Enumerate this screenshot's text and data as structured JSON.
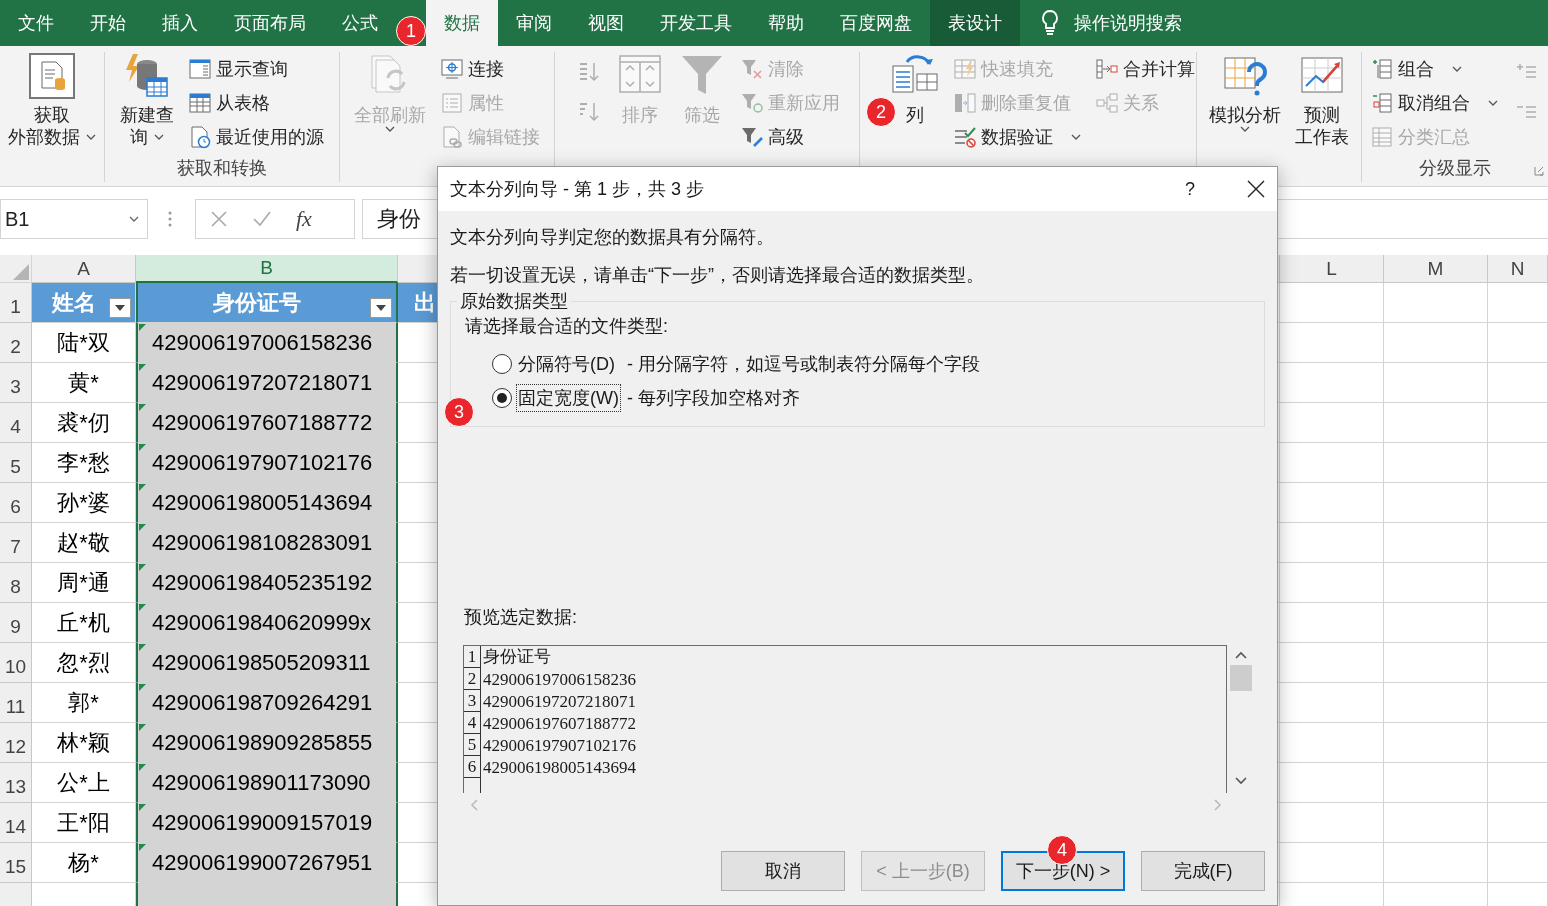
{
  "tabs": [
    {
      "label": "文件",
      "selected": false,
      "contextual": false
    },
    {
      "label": "开始",
      "selected": false,
      "contextual": false
    },
    {
      "label": "插入",
      "selected": false,
      "contextual": false
    },
    {
      "label": "页面布局",
      "selected": false,
      "contextual": false
    },
    {
      "label": "公式",
      "selected": false,
      "contextual": false
    },
    {
      "label": "数据",
      "selected": true,
      "contextual": false
    },
    {
      "label": "审阅",
      "selected": false,
      "contextual": false
    },
    {
      "label": "视图",
      "selected": false,
      "contextual": false
    },
    {
      "label": "开发工具",
      "selected": false,
      "contextual": false
    },
    {
      "label": "帮助",
      "selected": false,
      "contextual": false
    },
    {
      "label": "百度网盘",
      "selected": false,
      "contextual": false
    },
    {
      "label": "表设计",
      "selected": false,
      "contextual": true
    }
  ],
  "search": {
    "label": "操作说明搜索"
  },
  "ribbon": {
    "groups": [
      {
        "columns": [
          {
            "items": [
              {
                "kind": "large",
                "lines": [
                  "获取",
                  "外部数据"
                ],
                "disabled": false,
                "dropdown": true
              }
            ]
          }
        ]
      },
      {
        "label": "获取和转换",
        "columns": [
          {
            "items": [
              {
                "kind": "large",
                "lines": [
                  "新建查",
                  "询"
                ],
                "disabled": false,
                "dropdown": true
              }
            ]
          },
          {
            "items": [
              {
                "kind": "small",
                "label": "显示查询",
                "disabled": false,
                "dropdown": false
              },
              {
                "kind": "small",
                "label": "从表格",
                "disabled": false,
                "dropdown": false
              },
              {
                "kind": "small",
                "label": "最近使用的源",
                "disabled": false,
                "dropdown": false
              }
            ]
          }
        ]
      },
      {
        "columns": [
          {
            "items": [
              {
                "kind": "large",
                "lines": [
                  "全部刷新"
                ],
                "disabled": true,
                "dropdown": true
              }
            ]
          },
          {
            "items": [
              {
                "kind": "small",
                "label": "连接",
                "disabled": false,
                "dropdown": false
              },
              {
                "kind": "small",
                "label": "属性",
                "disabled": true,
                "dropdown": false
              },
              {
                "kind": "small",
                "label": "编辑链接",
                "disabled": true,
                "dropdown": false
              }
            ]
          }
        ]
      },
      {
        "columns": [
          {
            "items": [
              {
                "kind": "icon",
                "disabled": true,
                "dropdown": false
              },
              {
                "kind": "icon",
                "disabled": true,
                "dropdown": false
              }
            ]
          },
          {
            "items": [
              {
                "kind": "large",
                "lines": [
                  "排序"
                ],
                "disabled": true,
                "dropdown": false
              }
            ]
          },
          {
            "items": [
              {
                "kind": "large",
                "lines": [
                  "筛选"
                ],
                "disabled": true,
                "dropdown": false
              }
            ]
          },
          {
            "items": [
              {
                "kind": "small",
                "label": "清除",
                "disabled": true,
                "dropdown": false
              },
              {
                "kind": "small",
                "label": "重新应用",
                "disabled": true,
                "dropdown": false
              },
              {
                "kind": "small",
                "label": "高级",
                "disabled": false,
                "dropdown": false
              }
            ]
          }
        ]
      },
      {
        "columns": [
          {
            "items": [
              {
                "kind": "large",
                "lines": [
                  "列"
                ],
                "disabled": false,
                "dropdown": false
              }
            ]
          },
          {
            "items": [
              {
                "kind": "small",
                "label": "快速填充",
                "disabled": true,
                "dropdown": false
              },
              {
                "kind": "small",
                "label": "删除重复值",
                "disabled": true,
                "dropdown": false
              },
              {
                "kind": "small",
                "label": "数据验证",
                "disabled": false,
                "dropdown": true
              }
            ]
          },
          {
            "items": [
              {
                "kind": "small",
                "label": "合并计算",
                "disabled": false,
                "dropdown": false
              },
              {
                "kind": "small",
                "label": "关系",
                "disabled": true,
                "dropdown": false
              }
            ]
          }
        ]
      },
      {
        "columns": [
          {
            "items": [
              {
                "kind": "large",
                "lines": [
                  "模拟分析"
                ],
                "disabled": false,
                "dropdown": true
              }
            ]
          },
          {
            "items": [
              {
                "kind": "large",
                "lines": [
                  "预测",
                  "工作表"
                ],
                "disabled": false,
                "dropdown": false
              }
            ]
          }
        ]
      },
      {
        "label": "分级显示",
        "columns": [
          {
            "items": [
              {
                "kind": "small",
                "label": "组合",
                "disabled": false,
                "dropdown": true
              },
              {
                "kind": "small",
                "label": "取消组合",
                "disabled": false,
                "dropdown": true
              },
              {
                "kind": "small",
                "label": "分类汇总",
                "disabled": true,
                "dropdown": false
              }
            ]
          },
          {
            "items": [
              {
                "kind": "icon",
                "disabled": true,
                "dropdown": false
              },
              {
                "kind": "icon",
                "disabled": true,
                "dropdown": false
              }
            ]
          }
        ]
      }
    ]
  },
  "formula_bar": {
    "name_box": "B1",
    "function_label": "fx",
    "value": "身份"
  },
  "sheet": {
    "columns": [
      {
        "label": "A",
        "selected": false
      },
      {
        "label": "B",
        "selected": true
      }
    ],
    "columns_far": [
      {
        "label": "L",
        "selected": false
      },
      {
        "label": "M",
        "selected": false
      },
      {
        "label": "N",
        "selected": false
      }
    ],
    "header_row": {
      "row_number": "1",
      "cells": [
        {
          "text": "姓名",
          "filter": true
        },
        {
          "text": "身份证号",
          "filter": true
        },
        {
          "text": "出",
          "filter": false
        }
      ]
    },
    "rows": [
      {
        "row_number": "2",
        "name": "陆*双",
        "id": "429006197006158236",
        "flagged": true
      },
      {
        "row_number": "3",
        "name": "黄*",
        "id": "429006197207218071",
        "flagged": true
      },
      {
        "row_number": "4",
        "name": "裘*仞",
        "id": "429006197607188772",
        "flagged": true
      },
      {
        "row_number": "5",
        "name": "李*愁",
        "id": "429006197907102176",
        "flagged": true
      },
      {
        "row_number": "6",
        "name": "孙*婆",
        "id": "429006198005143694",
        "flagged": true
      },
      {
        "row_number": "7",
        "name": "赵*敬",
        "id": "429006198108283091",
        "flagged": true
      },
      {
        "row_number": "8",
        "name": "周*通",
        "id": "429006198405235192",
        "flagged": true
      },
      {
        "row_number": "9",
        "name": "丘*机",
        "id": "42900619840620999x",
        "flagged": true
      },
      {
        "row_number": "10",
        "name": "忽*烈",
        "id": "429006198505209311",
        "flagged": true
      },
      {
        "row_number": "11",
        "name": "郭*",
        "id": "429006198709264291",
        "flagged": true
      },
      {
        "row_number": "12",
        "name": "林*颖",
        "id": "429006198909285855",
        "flagged": true
      },
      {
        "row_number": "13",
        "name": "公*上",
        "id": "429006198901173090",
        "flagged": true
      },
      {
        "row_number": "14",
        "name": "王*阳",
        "id": "429006199009157019",
        "flagged": true
      },
      {
        "row_number": "15",
        "name": "杨*",
        "id": "429006199007267951",
        "flagged": true
      }
    ]
  },
  "dialog": {
    "title": "文本分列向导 - 第 1 步，共 3 步",
    "help": "?",
    "intro": "文本分列向导判定您的数据具有分隔符。",
    "instruction": "若一切设置无误，请单击“下一步”，否则请选择最合适的数据类型。",
    "group_title": "原始数据类型",
    "prompt": "请选择最合适的文件类型:",
    "options": [
      {
        "label": "分隔符号(D)",
        "description": "- 用分隔字符，如逗号或制表符分隔每个字段",
        "selected": false
      },
      {
        "label": "固定宽度(W)",
        "description": "- 每列字段加空格对齐",
        "selected": true
      }
    ],
    "preview_label": "预览选定数据:",
    "preview_rows": [
      {
        "number": "1",
        "text": "身份证号"
      },
      {
        "number": "2",
        "text": "429006197006158236"
      },
      {
        "number": "3",
        "text": "429006197207218071"
      },
      {
        "number": "4",
        "text": "429006197607188772"
      },
      {
        "number": "5",
        "text": "429006197907102176"
      },
      {
        "number": "6",
        "text": "429006198005143694"
      }
    ],
    "buttons": [
      {
        "label": "取消",
        "disabled": false,
        "default": false
      },
      {
        "label": "< 上一步(B)",
        "disabled": true,
        "default": false
      },
      {
        "label": "下一步(N) >",
        "disabled": false,
        "default": true
      },
      {
        "label": "完成(F)",
        "disabled": false,
        "default": false
      }
    ]
  },
  "badges": [
    {
      "label": "1"
    },
    {
      "label": "2"
    },
    {
      "label": "3"
    },
    {
      "label": "4"
    }
  ]
}
